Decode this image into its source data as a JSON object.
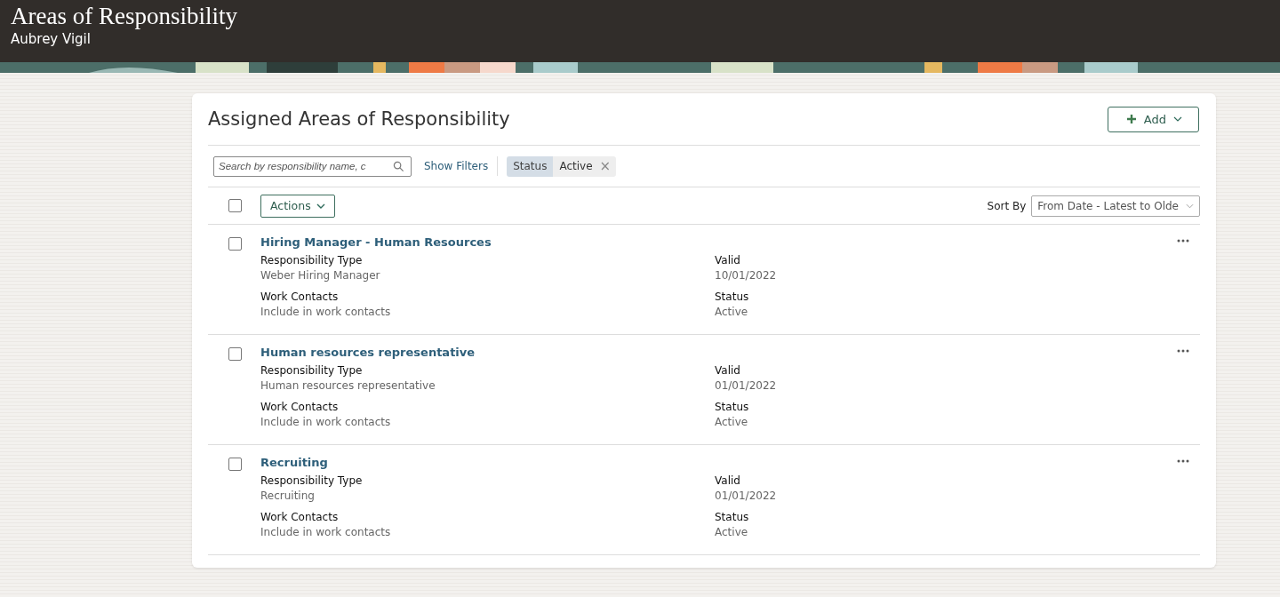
{
  "header": {
    "title": "Areas of Responsibility",
    "subtitle": "Aubrey Vigil"
  },
  "panel": {
    "title": "Assigned Areas of Responsibility",
    "add_button": "Add",
    "search": {
      "placeholder": "Search by responsibility name, c"
    },
    "show_filters": "Show Filters",
    "filter_chip": {
      "name": "Status",
      "value": "Active",
      "remove": "×"
    },
    "select_all": {
      "checked": false
    },
    "actions_button": "Actions",
    "sort": {
      "label": "Sort By",
      "value": "From Date - Latest to Olde"
    },
    "rows": [
      {
        "checked": false,
        "title": "Hiring Manager - Human Resources",
        "fields": [
          {
            "label": "Responsibility Type",
            "value": "Weber Hiring Manager"
          },
          {
            "label": "Valid",
            "value": "10/01/2022"
          },
          {
            "label": "Work Contacts",
            "value": "Include in work contacts"
          },
          {
            "label": "Status",
            "value": "Active"
          }
        ]
      },
      {
        "checked": false,
        "title": "Human resources representative",
        "fields": [
          {
            "label": "Responsibility Type",
            "value": "Human resources representative"
          },
          {
            "label": "Valid",
            "value": "01/01/2022"
          },
          {
            "label": "Work Contacts",
            "value": "Include in work contacts"
          },
          {
            "label": "Status",
            "value": "Active"
          }
        ]
      },
      {
        "checked": false,
        "title": "Recruiting",
        "fields": [
          {
            "label": "Responsibility Type",
            "value": "Recruiting"
          },
          {
            "label": "Valid",
            "value": "01/01/2022"
          },
          {
            "label": "Work Contacts",
            "value": "Include in work contacts"
          },
          {
            "label": "Status",
            "value": "Active"
          }
        ]
      }
    ]
  }
}
